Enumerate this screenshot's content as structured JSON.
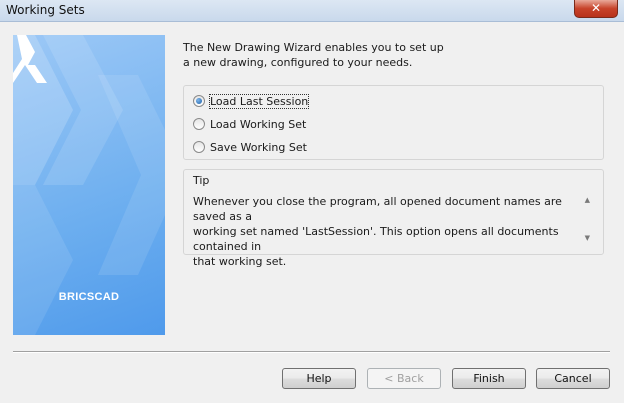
{
  "window": {
    "title": "Working Sets",
    "close_glyph": "✕"
  },
  "brand": {
    "name": "BRICSCAD",
    "colors": {
      "panel_light": "#9cc8f6",
      "panel_dark": "#4f9aeb"
    }
  },
  "intro": {
    "line1": "The New Drawing Wizard enables you to set up",
    "line2": "a new drawing, configured to your needs."
  },
  "options": [
    {
      "label": "Load Last Session",
      "checked": true
    },
    {
      "label": "Load Working Set",
      "checked": false
    },
    {
      "label": "Save Working Set",
      "checked": false
    }
  ],
  "tip": {
    "title": "Tip",
    "line1": "Whenever you close the program, all opened document names are saved as a",
    "line2": "working set named 'LastSession'. This option opens all documents contained in",
    "line3": "that working set.",
    "scroll_up_glyph": "▲",
    "scroll_down_glyph": "▼"
  },
  "buttons": {
    "help": "Help",
    "back": "< Back",
    "finish": "Finish",
    "cancel": "Cancel"
  }
}
